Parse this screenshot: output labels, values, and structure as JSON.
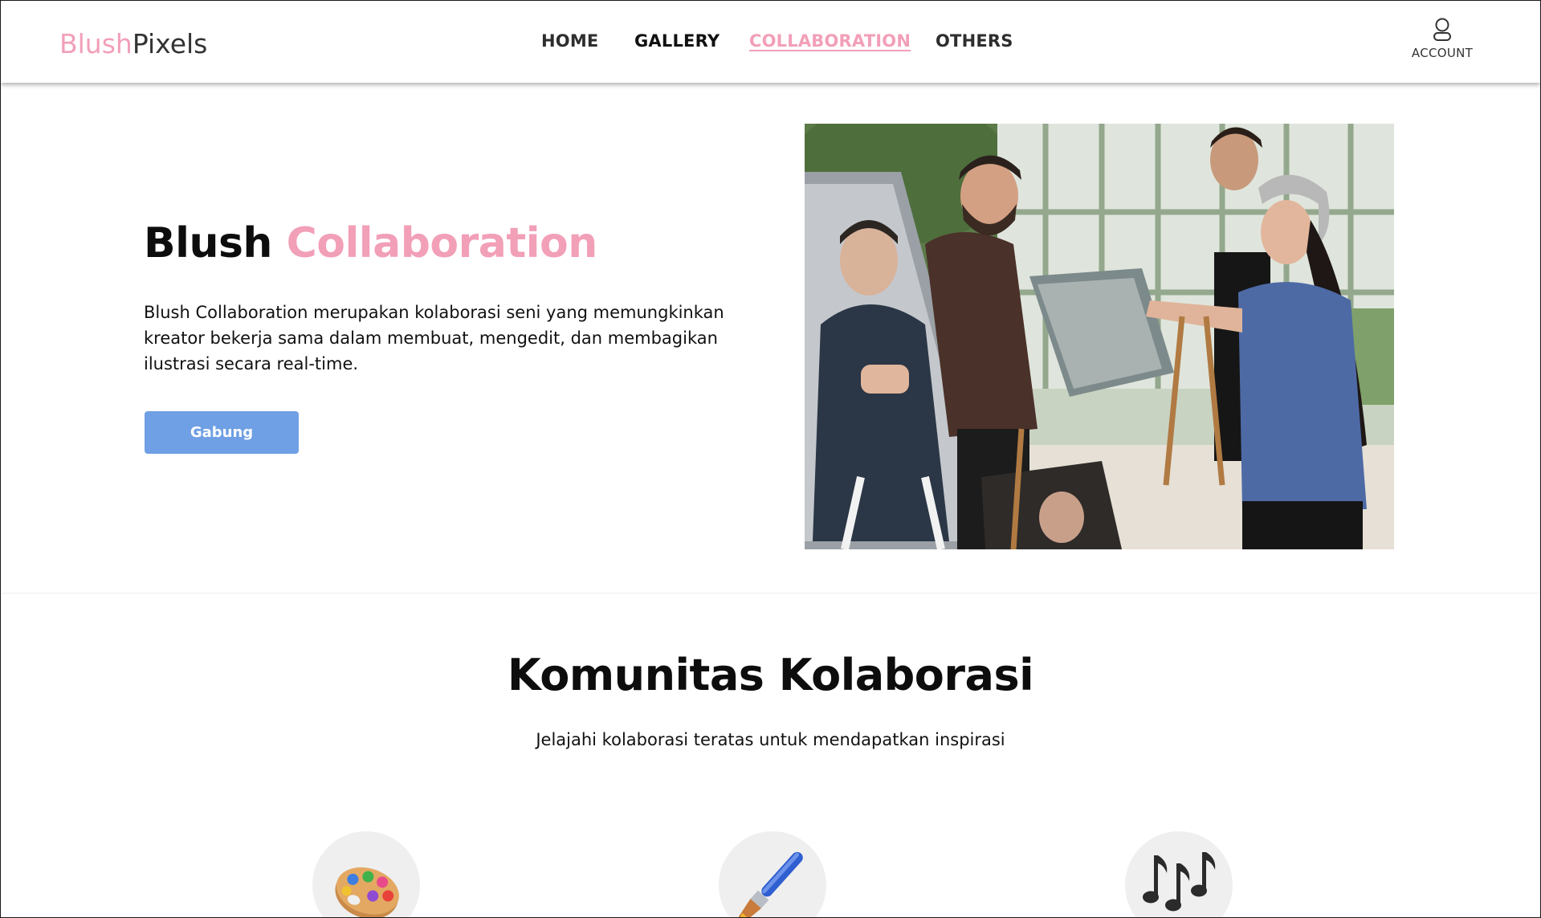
{
  "brand": {
    "part1": "Blush",
    "part2": "Pixels",
    "accent_color": "#f29fb8"
  },
  "nav": {
    "items": [
      {
        "label": "HOME"
      },
      {
        "label": "GALLERY"
      },
      {
        "label": "COLLABORATION",
        "active": true
      },
      {
        "label": "OTHERS"
      }
    ],
    "account_label": "ACCOUNT",
    "account_icon": "user-icon"
  },
  "hero": {
    "title_part1": "Blush",
    "title_part2": "Collaboration",
    "description": "Blush Collaboration merupakan kolaborasi seni yang memungkinkan kreator bekerja sama dalam membuat, mengedit, dan membagikan ilustrasi secara real-time.",
    "button_label": "Gabung",
    "button_color": "#6f9fe4"
  },
  "community": {
    "title": "Komunitas Kolaborasi",
    "subtitle": "Jelajahi kolaborasi teratas untuk mendapatkan inspirasi",
    "categories": [
      {
        "icon": "palette-icon"
      },
      {
        "icon": "paintbrush-icon"
      },
      {
        "icon": "music-notes-icon"
      }
    ]
  }
}
